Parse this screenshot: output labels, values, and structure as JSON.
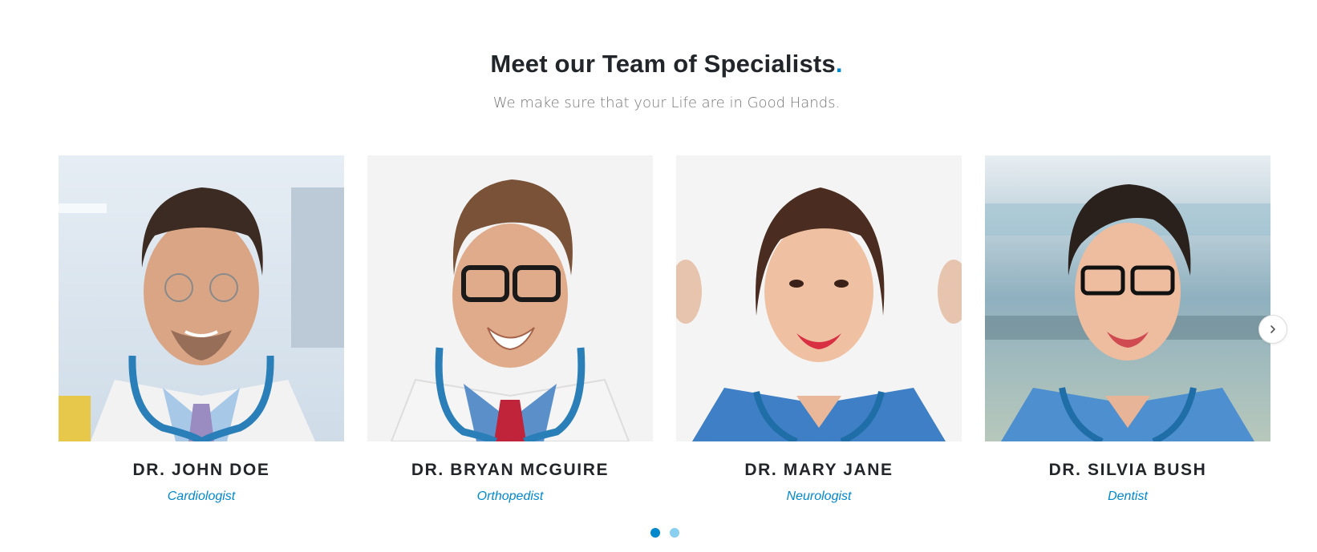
{
  "section": {
    "title": "Meet our Team of Specialists",
    "title_dot": ".",
    "subtitle": "We make sure that your Life are in Good Hands."
  },
  "team": [
    {
      "name": "DR. JOHN DOE",
      "role": "Cardiologist",
      "photo": "male-doctor-portrait-photo"
    },
    {
      "name": "DR. BRYAN MCGUIRE",
      "role": "Orthopedist",
      "photo": "male-doctor-glasses-portrait-photo"
    },
    {
      "name": "DR. MARY JANE",
      "role": "Neurologist",
      "photo": "female-doctor-portrait-photo"
    },
    {
      "name": "DR. SILVIA BUSH",
      "role": "Dentist",
      "photo": "female-doctor-glasses-portrait-photo"
    }
  ],
  "carousel": {
    "next_icon": "chevron-right-icon",
    "page_count": 2,
    "active_page": 1
  },
  "colors": {
    "accent": "#0088cc",
    "dot_inactive": "#89cff0",
    "heading": "#222529",
    "subtitle": "#777777"
  }
}
